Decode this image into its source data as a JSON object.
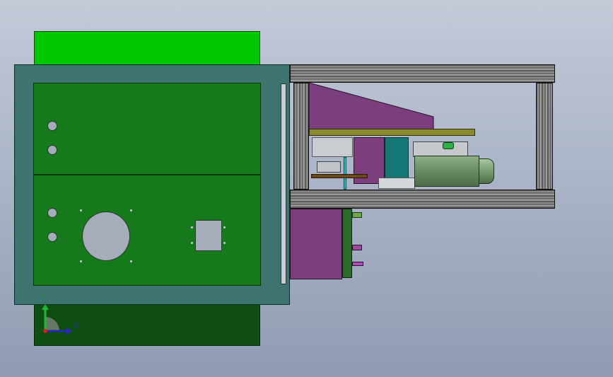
{
  "viewport": {
    "background_top": "#c3cad8",
    "background_bottom": "#8f9bb3"
  },
  "model": {
    "colors": {
      "top_tab": "#00c800",
      "frame": "#3d7470",
      "panel": "#167a1c",
      "bottom_skirt": "#0e4e12",
      "holes": "#a5adbb",
      "purple_block": "#7b3f7e",
      "teal_block": "#167777",
      "olive_plate": "#8a8a2e",
      "motor": "#6a8f64"
    },
    "left_panel_holes_upper": 2,
    "left_panel_holes_lower": 2
  },
  "triad": {
    "y_label": "Y",
    "z_label": "Z",
    "icon": "coordinate-triad-icon"
  }
}
